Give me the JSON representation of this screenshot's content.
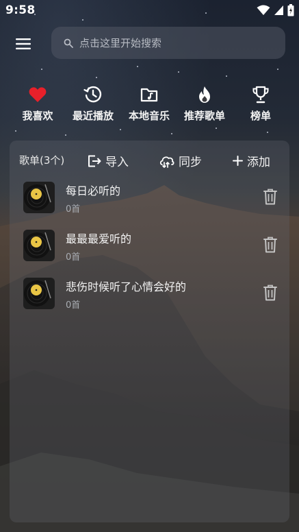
{
  "status_bar": {
    "time": "9:58"
  },
  "search": {
    "placeholder": "点击这里开始搜索"
  },
  "quick_nav": [
    {
      "label": "我喜欢",
      "icon": "heart-icon"
    },
    {
      "label": "最近播放",
      "icon": "history-icon"
    },
    {
      "label": "本地音乐",
      "icon": "music-folder-icon"
    },
    {
      "label": "推荐歌单",
      "icon": "fire-icon"
    },
    {
      "label": "榜单",
      "icon": "trophy-icon"
    }
  ],
  "playlist_panel": {
    "title": "歌单(3个)",
    "import_label": "导入",
    "sync_label": "同步",
    "add_label": "添加",
    "playlists": [
      {
        "name": "每日必听的",
        "count": "0首"
      },
      {
        "name": "最最最爱听的",
        "count": "0首"
      },
      {
        "name": "悲伤时候听了心情会好的",
        "count": "0首"
      }
    ]
  },
  "colors": {
    "heart": "#e8202a",
    "panel_bg": "#646870",
    "record_label": "#e9c545"
  }
}
